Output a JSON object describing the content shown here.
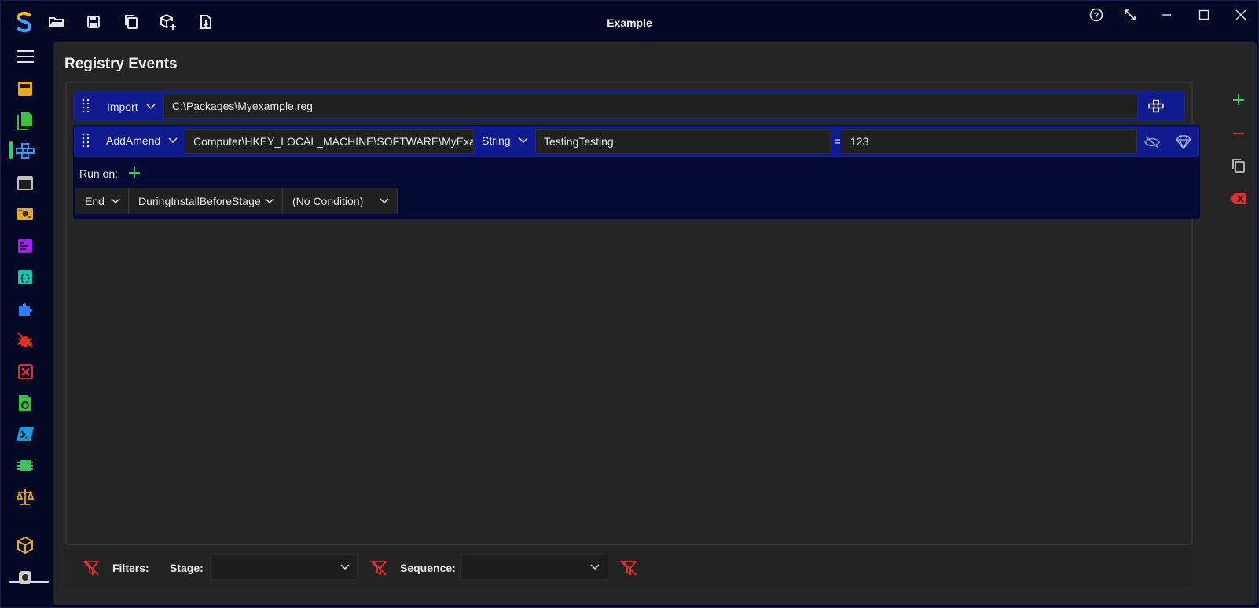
{
  "window": {
    "title": "Example"
  },
  "toolbar": {
    "icons": [
      "logo-icon",
      "open-folder-icon",
      "save-icon",
      "copy-icon",
      "new-package-icon",
      "import-file-icon"
    ]
  },
  "window_controls": [
    "help-icon",
    "resize-icon",
    "minimize-icon",
    "maximize-icon",
    "close-icon"
  ],
  "nav": {
    "items": [
      "menu-icon",
      "package-icon",
      "files-icon",
      "registry-icon",
      "window-icon",
      "certificate-icon",
      "terminal-icon",
      "json-icon",
      "puzzle-icon",
      "bug-icon",
      "remove-icon",
      "script-file-icon",
      "powershell-icon",
      "chip-icon",
      "scale-icon",
      "box-icon",
      "settings-icon"
    ],
    "active": "registry-icon"
  },
  "page": {
    "title": "Registry Events"
  },
  "events": [
    {
      "type": "Import",
      "path": "C:\\Packages\\Myexample.reg"
    },
    {
      "type": "AddAmend",
      "key": "Computer\\HKEY_LOCAL_MACHINE\\SOFTWARE\\MyExampl",
      "value_type": "String",
      "name": "TestingTesting",
      "equals": "=",
      "value": "123",
      "run_on_label": "Run on:",
      "conditions": {
        "position": "End",
        "stage": "DuringInstallBeforeStage",
        "condition": "(No Condition)"
      }
    }
  ],
  "side_actions": [
    "add-icon",
    "remove-icon",
    "duplicate-icon",
    "delete-icon"
  ],
  "filters": {
    "label": "Filters:",
    "stage_label": "Stage:",
    "stage_value": "",
    "sequence_label": "Sequence:",
    "sequence_value": ""
  },
  "colors": {
    "accent_blue": "#0e1a8e",
    "add_green": "#2bd46a",
    "remove_red": "#e03030",
    "panel": "#252525",
    "background": "#030824"
  }
}
